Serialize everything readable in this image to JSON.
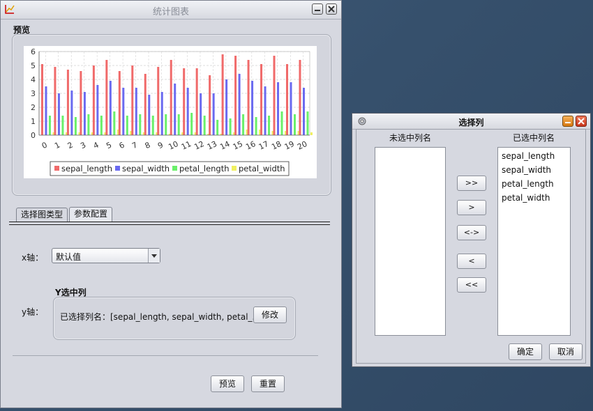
{
  "main_window": {
    "title": "统计图表",
    "preview_section_label": "预览",
    "tabs": [
      {
        "label": "选择图类型"
      },
      {
        "label": "参数配置"
      }
    ],
    "x_axis_label": "x轴：",
    "x_axis_value": "默认值",
    "y_axis_label": "y轴：",
    "y_group_title": "Y选中列",
    "y_selected_text": "已选择列名：[sepal_length, sepal_width, petal_...",
    "modify_button": "修改",
    "preview_button": "预览",
    "reset_button": "重置"
  },
  "dialog": {
    "title": "选择列",
    "unselected_header": "未选中列名",
    "selected_header": "已选中列名",
    "unselected_items": [],
    "selected_items": [
      "sepal_length",
      "sepal_width",
      "petal_length",
      "petal_width"
    ],
    "transfer_buttons": [
      ">>",
      ">",
      "<->",
      "<",
      "<<"
    ],
    "ok_button": "确定",
    "cancel_button": "取消"
  },
  "colors": {
    "sepal_length": "#f06a6a",
    "sepal_width": "#6a6af0",
    "petal_length": "#6af06a",
    "petal_width": "#f0f060"
  },
  "chart_data": {
    "type": "bar",
    "categories": [
      "0",
      "1",
      "2",
      "3",
      "4",
      "5",
      "6",
      "7",
      "8",
      "9",
      "10",
      "11",
      "12",
      "13",
      "14",
      "15",
      "16",
      "17",
      "18",
      "19",
      "20"
    ],
    "ylim": [
      0,
      6
    ],
    "yticks": [
      "0",
      "1",
      "2",
      "3",
      "4",
      "5",
      "6"
    ],
    "grid": true,
    "legend_position": "bottom",
    "series": [
      {
        "name": "sepal_length",
        "values": [
          5.1,
          4.9,
          4.7,
          4.6,
          5.0,
          5.4,
          4.6,
          5.0,
          4.4,
          4.9,
          5.4,
          4.8,
          4.8,
          4.3,
          5.8,
          5.7,
          5.4,
          5.1,
          5.7,
          5.1,
          5.4
        ]
      },
      {
        "name": "sepal_width",
        "values": [
          3.5,
          3.0,
          3.2,
          3.1,
          3.6,
          3.9,
          3.4,
          3.4,
          2.9,
          3.1,
          3.7,
          3.4,
          3.0,
          3.0,
          4.0,
          4.4,
          3.9,
          3.5,
          3.8,
          3.8,
          3.4
        ]
      },
      {
        "name": "petal_length",
        "values": [
          1.4,
          1.4,
          1.3,
          1.5,
          1.4,
          1.7,
          1.4,
          1.5,
          1.4,
          1.5,
          1.5,
          1.6,
          1.4,
          1.1,
          1.2,
          1.5,
          1.3,
          1.4,
          1.7,
          1.5,
          1.7
        ]
      },
      {
        "name": "petal_width",
        "values": [
          0.2,
          0.2,
          0.2,
          0.2,
          0.2,
          0.4,
          0.3,
          0.2,
          0.2,
          0.1,
          0.2,
          0.2,
          0.1,
          0.1,
          0.2,
          0.4,
          0.4,
          0.3,
          0.3,
          0.3,
          0.2
        ]
      }
    ]
  }
}
